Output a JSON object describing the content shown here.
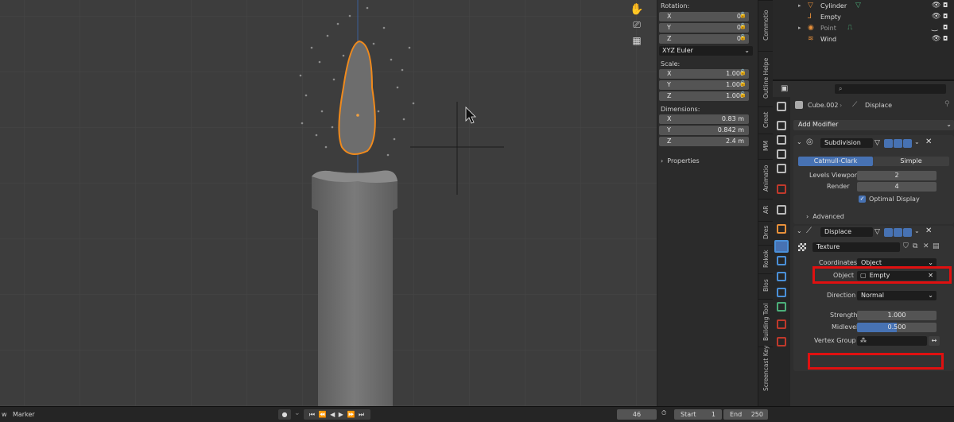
{
  "npanel": {
    "rotation_label": "Rotation:",
    "rotation": [
      {
        "axis": "X",
        "value": "0°"
      },
      {
        "axis": "Y",
        "value": "0°"
      },
      {
        "axis": "Z",
        "value": "0°"
      }
    ],
    "rotation_mode": "XYZ Euler",
    "scale_label": "Scale:",
    "scale": [
      {
        "axis": "X",
        "value": "1.000"
      },
      {
        "axis": "Y",
        "value": "1.000"
      },
      {
        "axis": "Z",
        "value": "1.000"
      }
    ],
    "dimensions_label": "Dimensions:",
    "dimensions": [
      {
        "axis": "X",
        "value": "0.83 m"
      },
      {
        "axis": "Y",
        "value": "0.842 m"
      },
      {
        "axis": "Z",
        "value": "2.4 m"
      }
    ],
    "properties_label": "Properties"
  },
  "tabs": [
    "Commotio",
    "Outline Helpe",
    "Creat",
    "MM",
    "Animatio",
    "AR",
    "Dres",
    "Rokok",
    "Blos",
    "Building Tool",
    "Screencast Key"
  ],
  "outliner": {
    "items": [
      {
        "name": "Cylinder",
        "color": "#e8903a"
      },
      {
        "name": "Empty",
        "color": "#e8903a"
      },
      {
        "name": "Point",
        "color": "#e8903a"
      },
      {
        "name": "Wind",
        "color": "#e8903a"
      }
    ]
  },
  "properties": {
    "search_placeholder": "",
    "breadcrumb_object": "Cube.002",
    "breadcrumb_modifier": "Displace",
    "add_modifier": "Add Modifier",
    "subdivision": {
      "name": "Subdivision",
      "tab_catmull": "Catmull-Clark",
      "tab_simple": "Simple",
      "levels_viewport_label": "Levels Viewport",
      "levels_viewport": "2",
      "render_label": "Render",
      "render": "4",
      "optimal_display": "Optimal Display",
      "advanced": "Advanced"
    },
    "displace": {
      "name": "Displace",
      "texture": "Texture",
      "coordinates_label": "Coordinates",
      "coordinates": "Object",
      "object_label": "Object",
      "object": "Empty",
      "direction_label": "Direction",
      "direction": "Normal",
      "strength_label": "Strength",
      "strength": "1.000",
      "midlevel_label": "Midlevel",
      "midlevel": "0.500",
      "midlevel_fraction": 0.5,
      "vertex_group_label": "Vertex Group",
      "vertex_group": ""
    }
  },
  "timeline": {
    "view": "w",
    "marker": "Marker",
    "current_frame": "46",
    "start_label": "Start",
    "start": "1",
    "end_label": "End",
    "end": "250"
  },
  "colors": {
    "accent": "#4772b3",
    "highlight": "#e01010",
    "selection": "#e8903a"
  }
}
